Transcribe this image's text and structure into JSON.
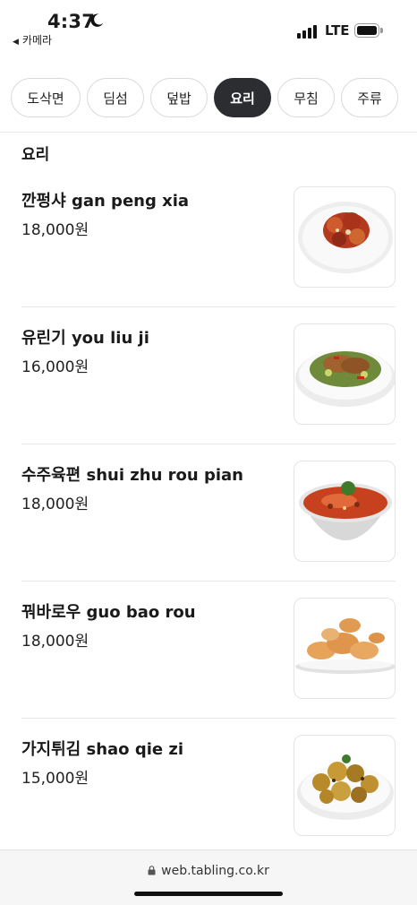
{
  "status_bar": {
    "time": "4:37",
    "back_app": "카메라",
    "network": "LTE",
    "icons": [
      "moon-icon",
      "signal-icon",
      "battery-icon"
    ]
  },
  "tabs": [
    {
      "label": "도삭면",
      "active": false
    },
    {
      "label": "딤섬",
      "active": false
    },
    {
      "label": "덮밥",
      "active": false
    },
    {
      "label": "요리",
      "active": true
    },
    {
      "label": "무침",
      "active": false
    },
    {
      "label": "주류",
      "active": false
    }
  ],
  "section": {
    "title": "요리"
  },
  "menu_items": [
    {
      "name": "깐펑샤 gan peng xia",
      "price": "18,000원",
      "image": "plate-shrimp-sauce"
    },
    {
      "name": "유린기 you liu ji",
      "price": "16,000원",
      "image": "plate-chicken-greens"
    },
    {
      "name": "수주육편 shui zhu rou pian",
      "price": "18,000원",
      "image": "bowl-spicy-soup"
    },
    {
      "name": "꿔바로우 guo bao rou",
      "price": "18,000원",
      "image": "plate-fried-pork"
    },
    {
      "name": "가지튀김 shao qie zi",
      "price": "15,000원",
      "image": "plate-fried-eggplant"
    }
  ],
  "browser": {
    "url": "web.tabling.co.kr"
  },
  "colors": {
    "active_tab": "#2b2d31",
    "border": "#d9d9d9",
    "text": "#1a1a1a"
  }
}
